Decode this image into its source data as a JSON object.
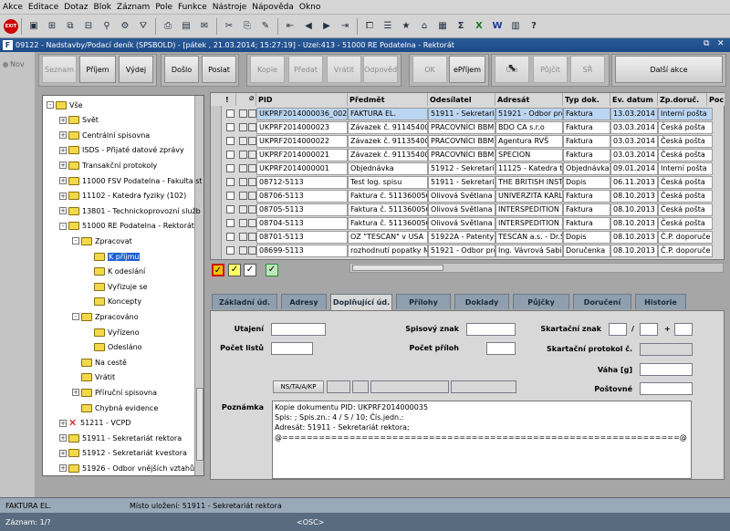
{
  "menu": [
    "Akce",
    "Editace",
    "Dotaz",
    "Blok",
    "Záznam",
    "Pole",
    "Funkce",
    "Nástroje",
    "Nápověda",
    "Okno"
  ],
  "window": {
    "title": "09122 - Nadstavby/Podací deník (SPSBOLD) - [pátek , 21.03.2014; 15:27:19] - Uzel:413 - 51000 RE Podatelna - Rektorát",
    "logo": "F"
  },
  "left_strip": {
    "label": "Nov"
  },
  "actions": {
    "seznam": "Seznam",
    "prijem": "Příjem",
    "vydej": "Výdej",
    "doslo": "Došlo",
    "poslat": "Poslat",
    "kopie": "Kopie",
    "predat": "Předat",
    "vratit": "Vrátit",
    "odpoved": "Odpověď",
    "ok": "OK",
    "eprijem": "ePříjem",
    "ulozit": "Ulo",
    "pujcit": "Půjčit",
    "sr": "SŘ",
    "dalsi": "Další akce"
  },
  "tree": [
    {
      "label": "Vše",
      "level": 0,
      "pm": "-"
    },
    {
      "label": "Svět",
      "level": 1,
      "pm": "+"
    },
    {
      "label": "Centrální spisovna",
      "level": 1,
      "pm": "+"
    },
    {
      "label": "ISDS - Přijaté datové zprávy",
      "level": 1,
      "pm": "+"
    },
    {
      "label": "Transakční protokoly",
      "level": 1,
      "pm": "+"
    },
    {
      "label": "11000 FSV Podatelna - Fakulta st",
      "level": 1,
      "pm": "+"
    },
    {
      "label": "11102 - Katedra fyziky (102)",
      "level": 1,
      "pm": "+"
    },
    {
      "label": "13801 - Technickoprovozní služb",
      "level": 1,
      "pm": "+"
    },
    {
      "label": "51000 RE Podatelna - Rektorát",
      "level": 1,
      "pm": "-"
    },
    {
      "label": "Zpracovat",
      "level": 2,
      "pm": "-"
    },
    {
      "label": "K příjmu",
      "level": 3,
      "pm": "",
      "selected": true
    },
    {
      "label": "K odeslání",
      "level": 3,
      "pm": ""
    },
    {
      "label": "Vyřizuje se",
      "level": 3,
      "pm": ""
    },
    {
      "label": "Koncepty",
      "level": 3,
      "pm": ""
    },
    {
      "label": "Zpracováno",
      "level": 2,
      "pm": "-"
    },
    {
      "label": "Vyřízeno",
      "level": 3,
      "pm": ""
    },
    {
      "label": "Odesláno",
      "level": 3,
      "pm": ""
    },
    {
      "label": "Na cestě",
      "level": 2,
      "pm": ""
    },
    {
      "label": "Vrátit",
      "level": 2,
      "pm": ""
    },
    {
      "label": "Příruční spisovna",
      "level": 2,
      "pm": "+"
    },
    {
      "label": "Chybná evidence",
      "level": 2,
      "pm": ""
    },
    {
      "label": "51211 - VCPD",
      "level": 1,
      "pm": "+",
      "x": true
    },
    {
      "label": "51911 - Sekretariát rektora",
      "level": 1,
      "pm": "+"
    },
    {
      "label": "51912 - Sekretariát kvestora",
      "level": 1,
      "pm": "+"
    },
    {
      "label": "51926 - Odbor vnějších vztahů",
      "level": 1,
      "pm": "+"
    }
  ],
  "table": {
    "headers": [
      "!",
      "",
      "PID",
      "Předmět",
      "Odesílatel",
      "Adresát",
      "Typ dok.",
      "Ev. datum",
      "Zp.doruč.",
      "Poc"
    ],
    "rows": [
      [
        "UKPRF2014000036_002",
        "FAKTURA EL.",
        "51911 - Sekretariá",
        "51921 - Odbor pro",
        "Faktura",
        "13.03.2014",
        "Interní pošta"
      ],
      [
        "UKPRF2014000023",
        "Závazek č. 911454000",
        "PRACOVNÍCI BBM",
        "BDO CA s.r.o",
        "Faktura",
        "03.03.2014",
        "Česká pošta"
      ],
      [
        "UKPRF2014000022",
        "Závazek č. 911354000",
        "PRACOVNÍCI BBM",
        "Agentura RVŠ",
        "Faktura",
        "03.03.2014",
        "Česká pošta"
      ],
      [
        "UKPRF2014000021",
        "Závazek č. 911354000",
        "PRACOVNÍCI BBM",
        "SPECION",
        "Faktura",
        "03.03.2014",
        "Česká pošta"
      ],
      [
        "UKPRF2014000001",
        "Objednávka",
        "51912 - Sekretariá",
        "11125 - Katedra te",
        "Objednávka",
        "09.01.2014",
        "Interní pošta"
      ],
      [
        "08712-5113",
        "Test log. spisu",
        "51911 - Sekretariá",
        "THE BRITISH INSTI",
        "Dopis",
        "06.11.2013",
        "Česká pošta"
      ],
      [
        "08706-5113",
        "Faktura č. 5113600569",
        "Olivová Světlana",
        "UNIVERZITA KARL",
        "Faktura",
        "08.10.2013",
        "Česká pošta"
      ],
      [
        "08705-5113",
        "Faktura č. 5113600569",
        "Olivová Světlana",
        "INTERSPEDITION Z",
        "Faktura",
        "08.10.2013",
        "Česká pošta"
      ],
      [
        "08704-5113",
        "Faktura č. 5113600569",
        "Olivová Světlana",
        "INTERSPEDITION Z",
        "Faktura",
        "08.10.2013",
        "Česká pošta"
      ],
      [
        "08701-5113",
        "OZ \"TESCAN\" v USA",
        "51922A - Patenty -",
        "TESCAN a.s. - Dr.S",
        "Dopis",
        "08.10.2013",
        "Č.P. doporuče"
      ],
      [
        "08699-5113",
        "rozhodnutí popatky MG",
        "51921 - Odbor pro",
        "Ing. Vávrová Sabin",
        "Doručenka",
        "08.10.2013",
        "Č.P. doporuče"
      ]
    ]
  },
  "tabs": [
    "Základní úd.",
    "Adresy",
    "Doplňující úd.",
    "Přílohy",
    "Doklady",
    "Půjčky",
    "Doručení",
    "Historie"
  ],
  "active_tab": 2,
  "form": {
    "utajeni": "Utajení",
    "pocet_listu": "Počet listů",
    "spisovy_znak": "Spisový znak",
    "pocet_priloh": "Počet příloh",
    "skartacni_znak": "Skartační znak",
    "slash": "/",
    "plus": "+",
    "skartacni_protokol": "Skartační protokol č.",
    "vaha": "Váha [g]",
    "postovne": "Poštovné",
    "ns_button": "NS/TA/A/KP",
    "poznamka": "Poznámka",
    "note_text": "Kopie dokumentu PID: UKPRF2014000035\nSpis: ; Spis.zn.: 4 / S / 10; Čís.jedn.:\nAdresát: 51911 - Sekretariát rektora;\n@=================================================================@"
  },
  "status": {
    "left": "FAKTURA EL.",
    "location": "Místo uložení: 51911 - Sekretariát rektora",
    "record": "Záznam: 1/?",
    "osc": "<OSC>"
  }
}
